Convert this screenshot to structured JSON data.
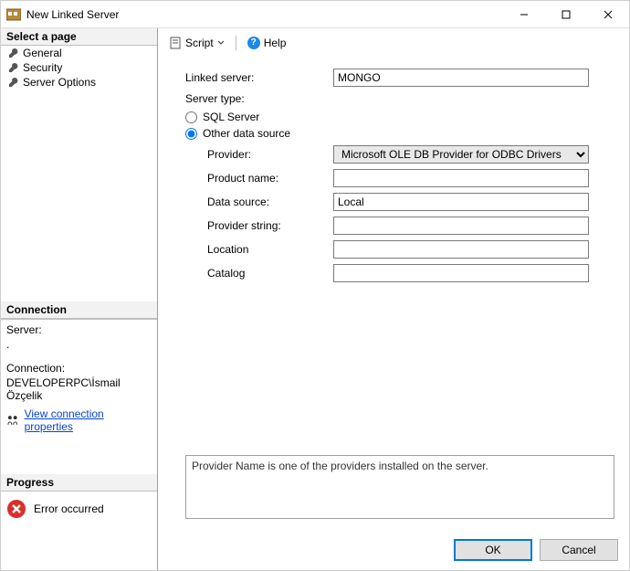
{
  "titlebar": {
    "title": "New Linked Server"
  },
  "sidebar": {
    "select_header": "Select a page",
    "pages": [
      "General",
      "Security",
      "Server Options"
    ],
    "connection_header": "Connection",
    "server_label": "Server:",
    "server_value": ".",
    "connection_label": "Connection:",
    "connection_value": "DEVELOPERPC\\İsmail Özçelik",
    "view_conn_link": "View connection properties",
    "progress_header": "Progress",
    "progress_status": "Error occurred"
  },
  "toolbar": {
    "script": "Script",
    "help": "Help"
  },
  "form": {
    "linked_server_label": "Linked server:",
    "linked_server_value": "MONGO",
    "server_type_label": "Server type:",
    "radio_sql": "SQL Server",
    "radio_other": "Other data source",
    "selected_server_type": "other",
    "provider_label": "Provider:",
    "provider_value": "Microsoft OLE DB Provider for ODBC Drivers",
    "product_label": "Product name:",
    "product_value": "",
    "datasource_label": "Data source:",
    "datasource_value": "Local",
    "provstr_label": "Provider string:",
    "provstr_value": "",
    "location_label": "Location",
    "location_value": "",
    "catalog_label": "Catalog",
    "catalog_value": "",
    "hint": "Provider Name is one of the providers installed on the server."
  },
  "footer": {
    "ok": "OK",
    "cancel": "Cancel"
  }
}
